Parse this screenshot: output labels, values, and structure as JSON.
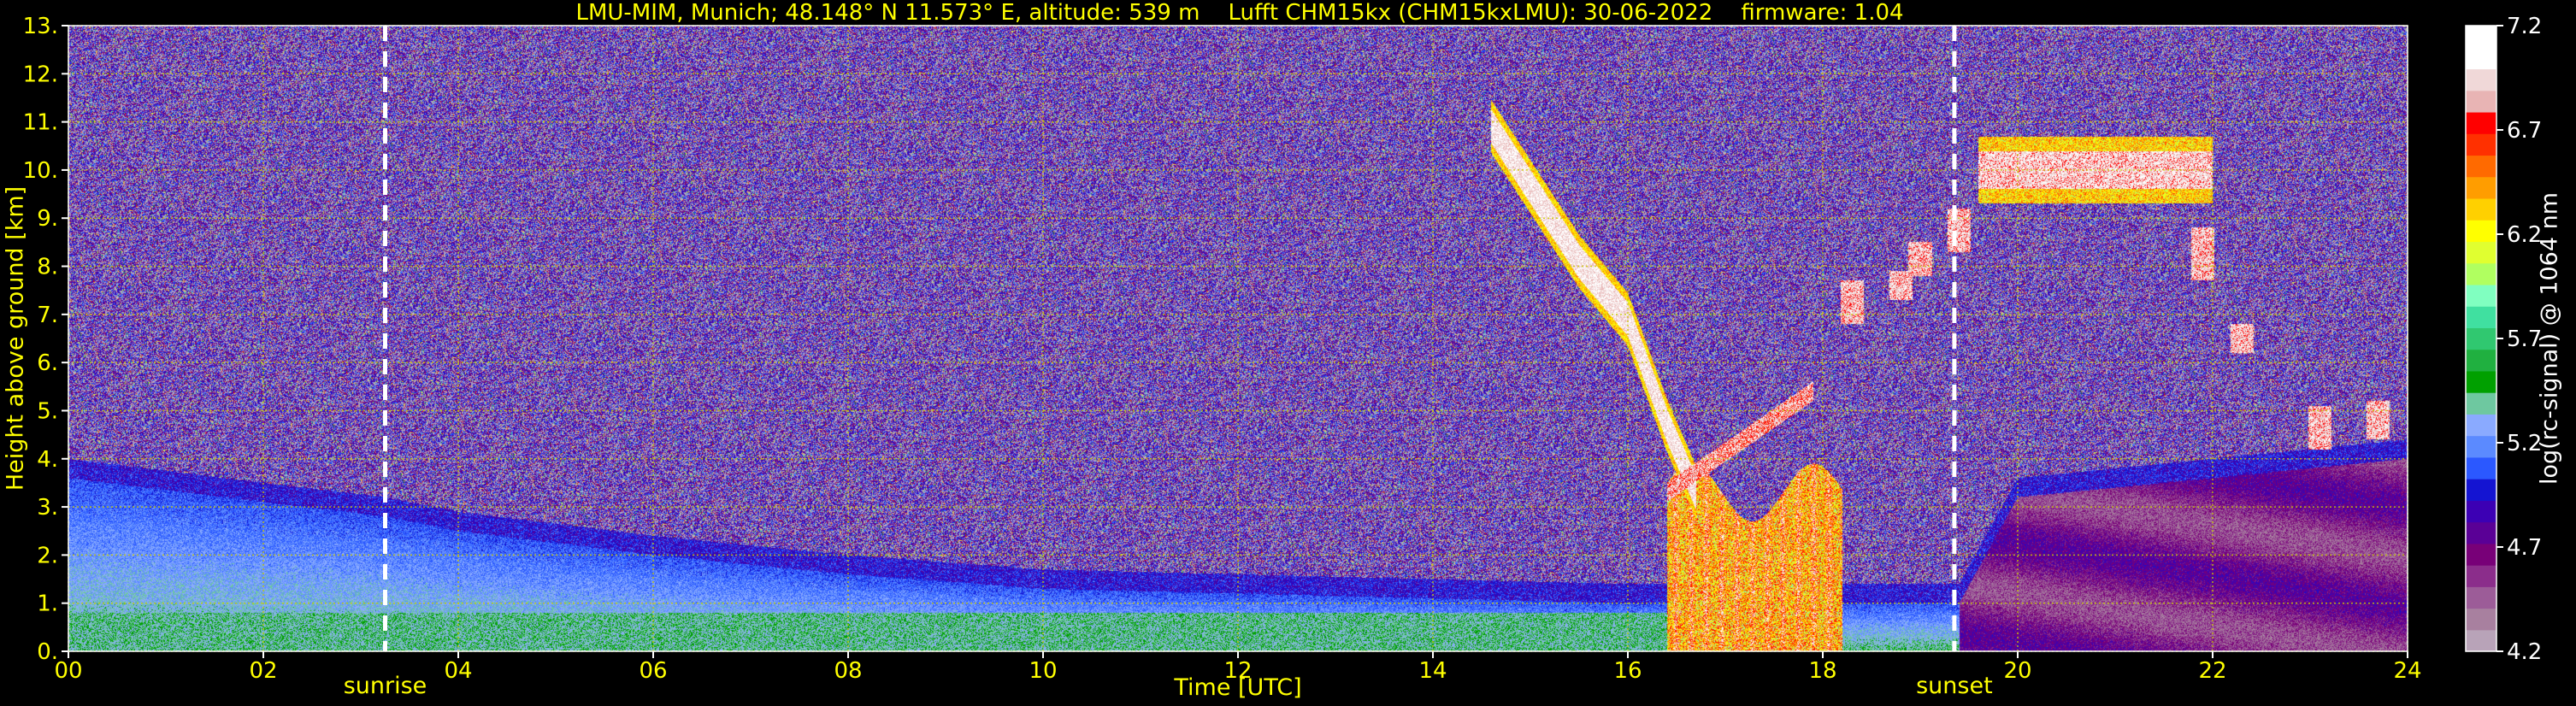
{
  "title": {
    "location": "LMU-MIM, Munich; 48.148° N 11.573° E, altitude: 539 m",
    "instrument": "Lufft CHM15kx (CHM15kxLMU): 30-06-2022",
    "firmware": "firmware: 1.04"
  },
  "colors": {
    "axis_text": "#ffff00",
    "grid": "#cccc00",
    "event_lines": "#ffffff",
    "colorbar_text": "#ffffff",
    "background": "#000000"
  },
  "chart_data": {
    "type": "heatmap",
    "xlabel": "Time [UTC]",
    "ylabel": "Height above ground [km]",
    "xlim": [
      0,
      24
    ],
    "ylim": [
      0,
      13
    ],
    "x_ticks": [
      "00",
      "02",
      "04",
      "06",
      "08",
      "10",
      "12",
      "14",
      "16",
      "18",
      "20",
      "22",
      "24"
    ],
    "y_ticks": [
      "0.",
      "1.",
      "2.",
      "3.",
      "4.",
      "5.",
      "6.",
      "7.",
      "8.",
      "9.",
      "10.",
      "11.",
      "12.",
      "13."
    ],
    "grid": true,
    "colorbar": {
      "label": "log(rc-signal) @ 1064 nm",
      "range": [
        4.2,
        7.2
      ],
      "ticks": [
        "4.2",
        "4.7",
        "5.2",
        "5.7",
        "6.2",
        "6.7",
        "7.2"
      ],
      "colors": [
        "#b8a3b8",
        "#a8809f",
        "#9c5c98",
        "#8b2d8b",
        "#780078",
        "#5a0096",
        "#3c00b4",
        "#1414d2",
        "#2b58ff",
        "#5b8aff",
        "#8aaaff",
        "#6ec8a0",
        "#00a000",
        "#20b040",
        "#30c870",
        "#40e0a0",
        "#80ffc0",
        "#b0ff60",
        "#e0ff30",
        "#ffff00",
        "#ffd000",
        "#ff9d00",
        "#ff6a00",
        "#ff3000",
        "#ff0000",
        "#e8b4b4",
        "#f0d8d8",
        "#ffffff",
        "#ffffff"
      ]
    },
    "events": [
      {
        "label": "sunrise",
        "time": 3.25
      },
      {
        "label": "sunset",
        "time": 19.35
      }
    ],
    "features": {
      "boundary_layer_top_km": [
        [
          0.0,
          3.6
        ],
        [
          2.0,
          3.1
        ],
        [
          3.25,
          2.8
        ],
        [
          4.0,
          2.5
        ],
        [
          6.0,
          2.0
        ],
        [
          8.0,
          1.6
        ],
        [
          10.0,
          1.3
        ],
        [
          12.0,
          1.2
        ],
        [
          14.0,
          1.1
        ],
        [
          16.0,
          1.0
        ],
        [
          19.4,
          1.0
        ],
        [
          20.0,
          3.2
        ],
        [
          24.0,
          4.0
        ]
      ],
      "descending_cloud_km": [
        [
          14.6,
          10.9
        ],
        [
          15.5,
          8.1
        ],
        [
          16.0,
          6.9
        ],
        [
          16.4,
          4.7
        ],
        [
          16.7,
          3.3
        ]
      ],
      "precipitation_period_h": [
        16.4,
        18.2
      ],
      "upper_cloud_layer": {
        "t_start": 19.6,
        "t_end": 22.0,
        "base_km": 9.3,
        "top_km": 10.7
      },
      "mid_cloud_patches": [
        [
          18.3,
          6.8,
          7.7
        ],
        [
          18.8,
          7.3,
          7.9
        ],
        [
          19.0,
          7.8,
          8.5
        ],
        [
          19.4,
          8.3,
          9.2
        ],
        [
          21.9,
          7.7,
          8.8
        ],
        [
          22.3,
          6.2,
          6.8
        ],
        [
          23.1,
          4.2,
          5.1
        ],
        [
          23.7,
          4.4,
          5.2
        ]
      ]
    }
  }
}
